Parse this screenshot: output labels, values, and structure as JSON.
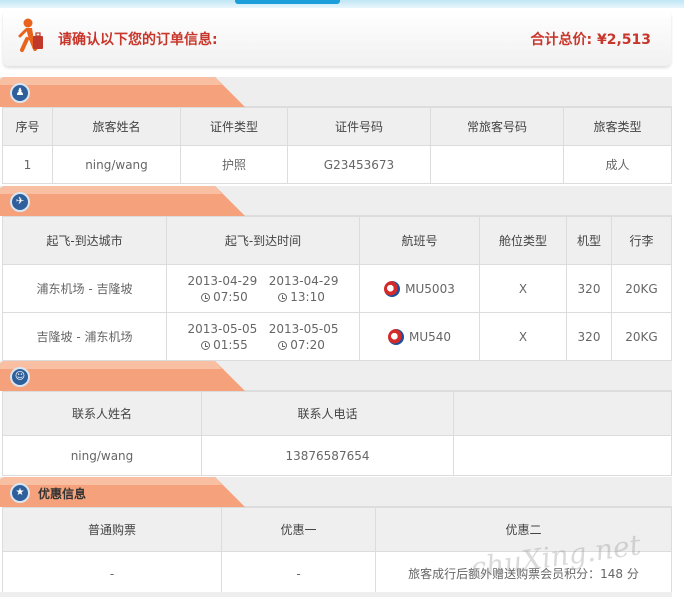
{
  "header": {
    "confirm_text": "请确认以下您的订单信息:",
    "total_text": "合计总价: ¥2,513"
  },
  "passengers": {
    "columns": [
      "序号",
      "旅客姓名",
      "证件类型",
      "证件号码",
      "常旅客号码",
      "旅客类型"
    ],
    "rows": [
      [
        "1",
        "ning/wang",
        "护照",
        "G23453673",
        "",
        "成人"
      ]
    ]
  },
  "flights": {
    "columns": [
      "起飞-到达城市",
      "起飞-到达时间",
      "航班号",
      "舱位类型",
      "机型",
      "行李"
    ],
    "rows": [
      {
        "route": "浦东机场 - 吉隆坡",
        "dep_date": "2013-04-29",
        "arr_date": "2013-04-29",
        "dep_time": "07:50",
        "arr_time": "13:10",
        "flight": "MU5003",
        "cabin": "X",
        "plane": "320",
        "luggage": "20KG"
      },
      {
        "route": "吉隆坡 - 浦东机场",
        "dep_date": "2013-05-05",
        "arr_date": "2013-05-05",
        "dep_time": "01:55",
        "arr_time": "07:20",
        "flight": "MU540",
        "cabin": "X",
        "plane": "320",
        "luggage": "20KG"
      }
    ]
  },
  "contact": {
    "columns": [
      "联系人姓名",
      "联系人电话",
      ""
    ],
    "row": [
      "ning/wang",
      "13876587654",
      ""
    ]
  },
  "discount": {
    "title": "优惠信息",
    "columns": [
      "普通购票",
      "优惠一",
      "优惠二"
    ],
    "row": [
      "-",
      "-",
      "旅客成行后额外赠送购票会员积分：148 分"
    ]
  },
  "watermark": "chuXing.net",
  "colors": {
    "accent_red": "#c8372c",
    "tab_orange": "#f5a27c",
    "icon_blue": "#2f5f9b"
  }
}
